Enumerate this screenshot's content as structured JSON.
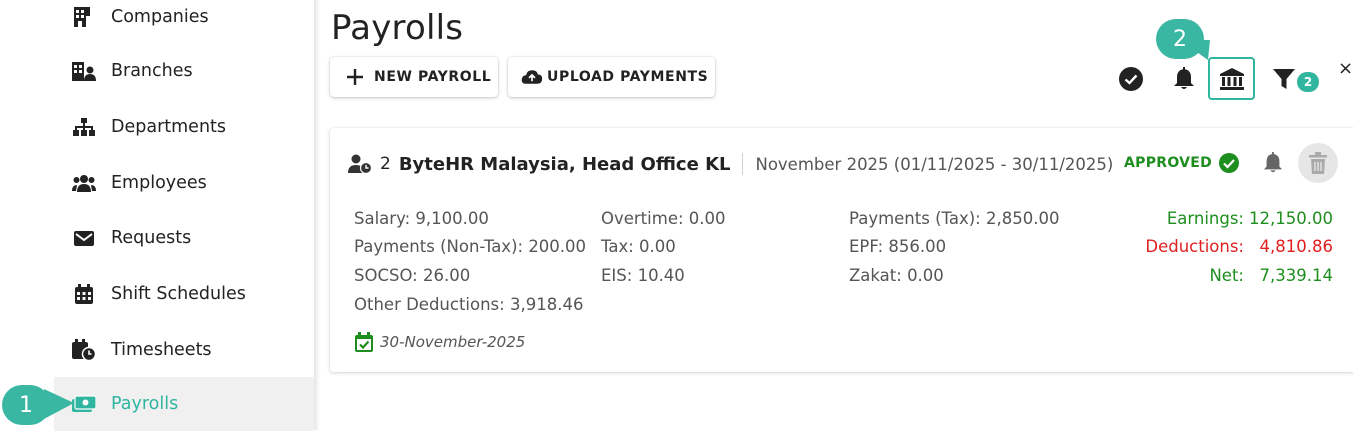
{
  "sidebar": {
    "items": [
      {
        "label": "Companies",
        "icon": "building-icon"
      },
      {
        "label": "Branches",
        "icon": "branches-icon"
      },
      {
        "label": "Departments",
        "icon": "sitemap-icon"
      },
      {
        "label": "Employees",
        "icon": "users-icon"
      },
      {
        "label": "Requests",
        "icon": "inbox-icon"
      },
      {
        "label": "Shift Schedules",
        "icon": "calendar-icon"
      },
      {
        "label": "Timesheets",
        "icon": "calendar-clock-icon"
      },
      {
        "label": "Payrolls",
        "icon": "money-icon",
        "active": true
      }
    ]
  },
  "header": {
    "title": "Payrolls",
    "new_payroll_label": "NEW PAYROLL",
    "upload_payments_label": "UPLOAD PAYMENTS",
    "filter_count": "2",
    "close_label": "×"
  },
  "payroll": {
    "employee_count": "2",
    "company": "ByteHR Malaysia,  Head Office KL",
    "period": "November 2025  (01/11/2025 - 30/11/2025)",
    "status": "APPROVED",
    "col1": [
      "Salary: 9,100.00",
      "Payments (Non-Tax): 200.00",
      "SOCSO: 26.00",
      "Other Deductions: 3,918.46"
    ],
    "col2": [
      "Overtime: 0.00",
      "Tax: 0.00",
      "EIS: 10.40"
    ],
    "col3": [
      "Payments (Tax): 2,850.00",
      "EPF: 856.00",
      "Zakat: 0.00"
    ],
    "totals": {
      "earnings_label": "Earnings:",
      "earnings_value": "12,150.00",
      "deductions_label": "Deductions:",
      "deductions_value": "4,810.86",
      "net_label": "Net:",
      "net_value": "7,339.14"
    },
    "date": "30-November-2025"
  },
  "callouts": {
    "one": "1",
    "two": "2"
  },
  "colors": {
    "accent": "#2fb5a0",
    "approved": "#1e8e1e",
    "deduction": "#e02020"
  }
}
